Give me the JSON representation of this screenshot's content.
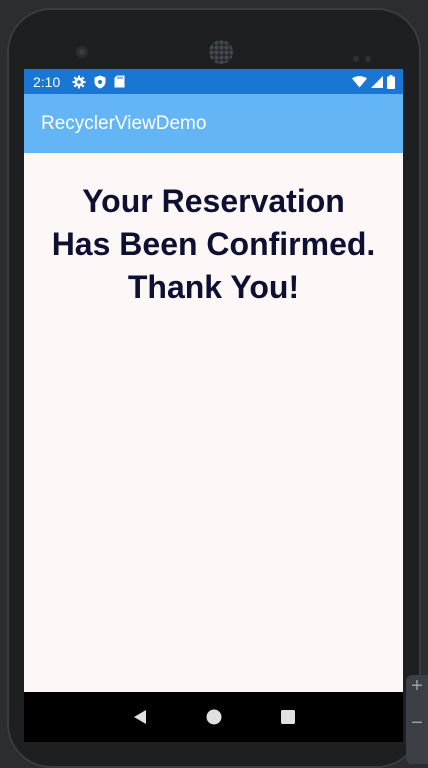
{
  "status_bar": {
    "time": "2:10",
    "left_icons": [
      "gear-icon",
      "shield-icon",
      "sd-card-icon"
    ],
    "right_icons": [
      "wifi-icon",
      "signal-icon",
      "battery-icon"
    ],
    "color": "#1976d2"
  },
  "app_bar": {
    "title": "RecyclerViewDemo",
    "color": "#64b5f6"
  },
  "content": {
    "line1": "Your Reservation",
    "line2": "Has Been Confirmed.",
    "line3": "Thank You!",
    "text_color": "#0d1030",
    "background": "#fdf8f7"
  },
  "nav_bar": {
    "buttons": [
      "back-icon",
      "home-icon",
      "recents-icon"
    ]
  },
  "emulator_side": {
    "buttons": [
      "+",
      "−"
    ]
  }
}
